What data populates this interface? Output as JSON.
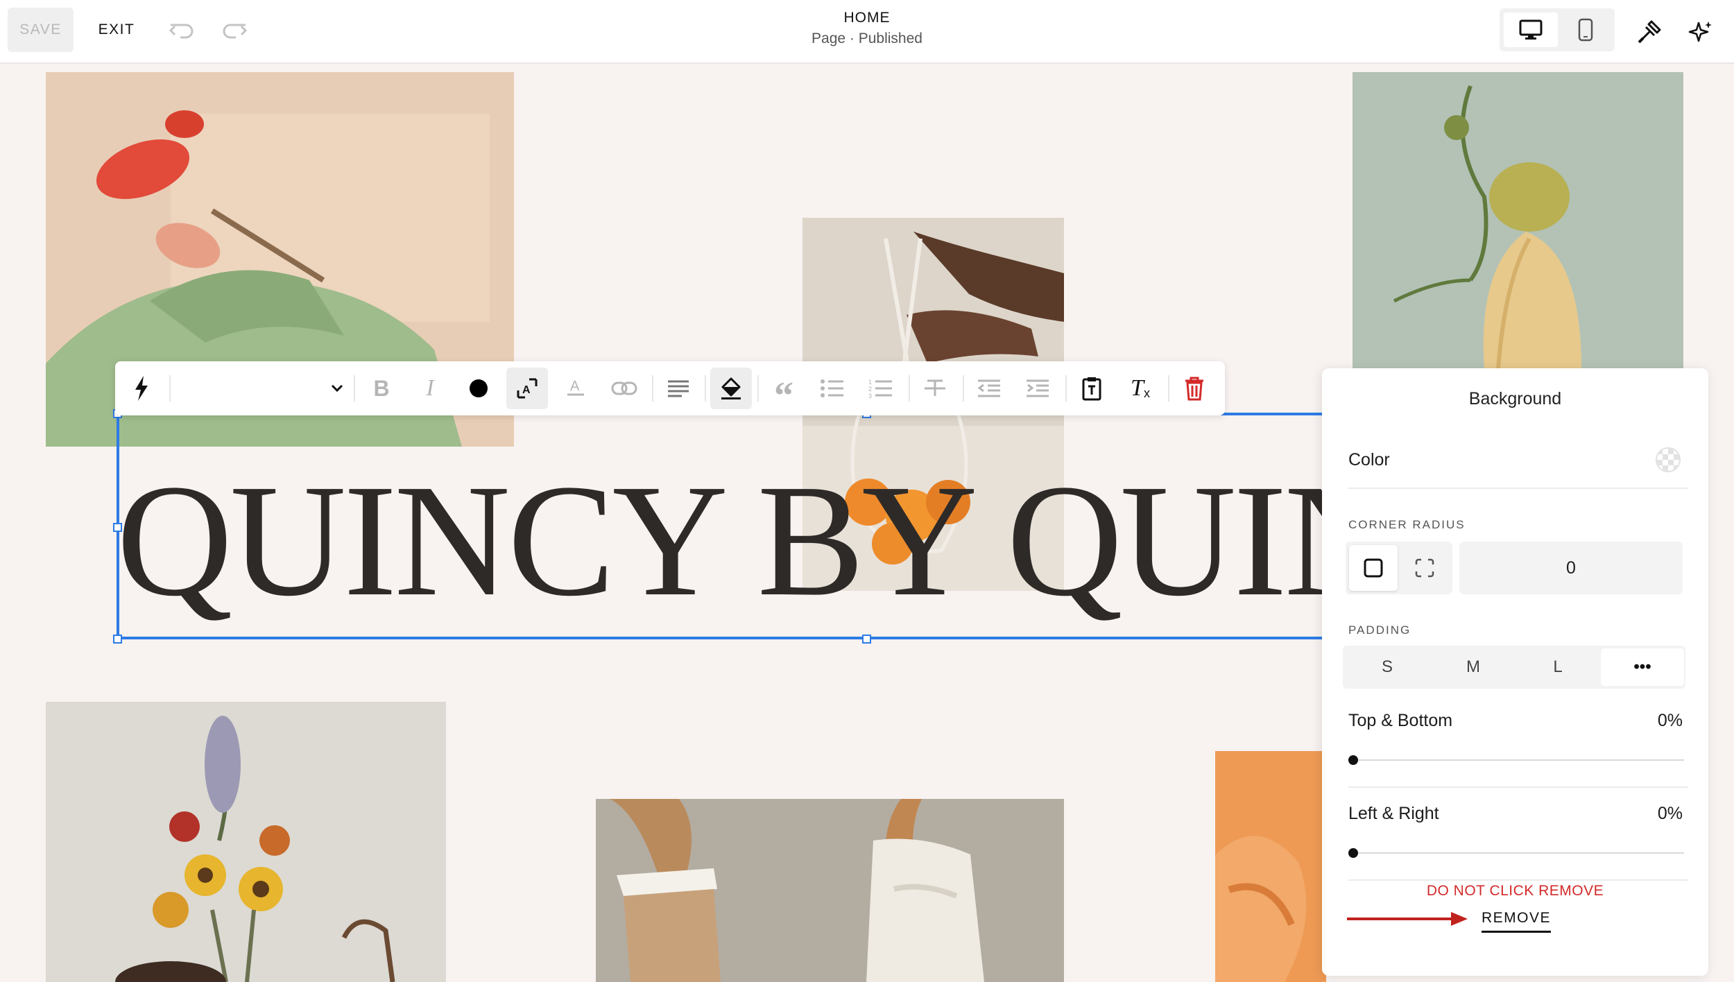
{
  "topbar": {
    "save_label": "SAVE",
    "exit_label": "EXIT",
    "page_name": "HOME",
    "page_status": "Page · Published"
  },
  "heading": {
    "text": "QUINCY BY QUINCE"
  },
  "panel": {
    "title": "Background",
    "color_label": "Color",
    "corner_radius_label": "CORNER RADIUS",
    "corner_radius_value": "0",
    "padding_label": "PADDING",
    "padding_options": [
      "S",
      "M",
      "L",
      "•••"
    ],
    "padding_selected": "•••",
    "top_bottom_label": "Top & Bottom",
    "top_bottom_value": "0%",
    "left_right_label": "Left & Right",
    "left_right_value": "0%",
    "warning_text": "DO NOT CLICK REMOVE",
    "remove_label": "REMOVE"
  },
  "colors": {
    "accent": "#2d7be5",
    "warning": "#d42a2a",
    "delete_icon": "#d42a2a",
    "canvas_bg": "#f8f2f1"
  },
  "toolbar_icons": [
    "lightning-icon",
    "font-dropdown",
    "bold-icon",
    "italic-icon",
    "text-color-icon",
    "text-size-icon",
    "text-highlight-icon",
    "link-icon",
    "align-left-icon",
    "fill-bucket-icon",
    "quote-icon",
    "bullet-list-icon",
    "numbered-list-icon",
    "strikethrough-icon",
    "outdent-icon",
    "indent-icon",
    "paste-text-icon",
    "clear-format-icon",
    "trash-icon"
  ]
}
